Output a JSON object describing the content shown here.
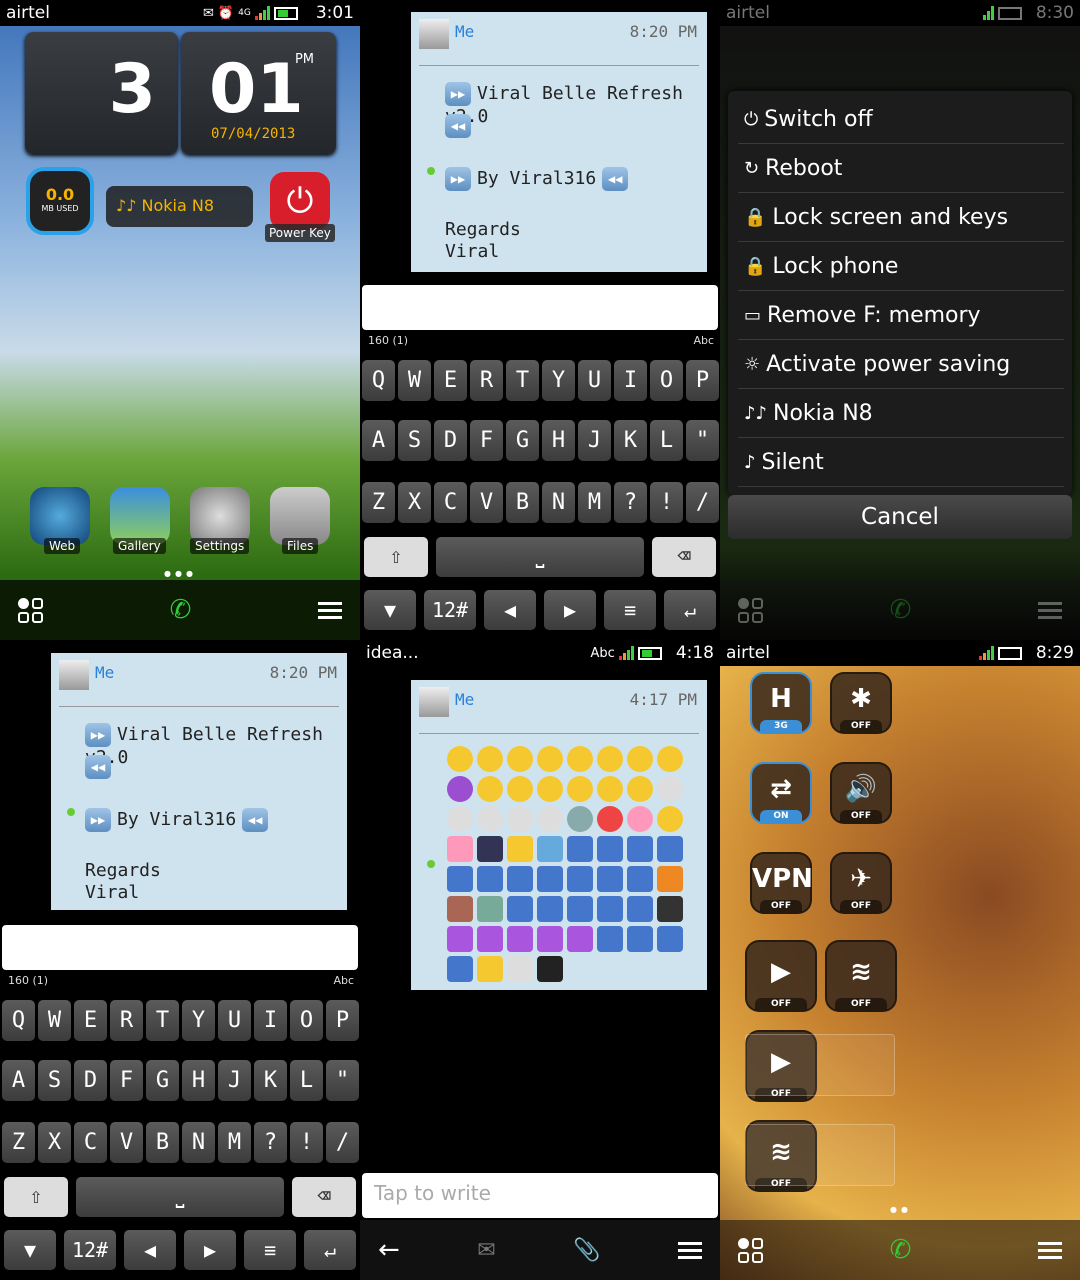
{
  "home": {
    "status": {
      "carrier": "airtel",
      "time": "3:01",
      "network": "4G"
    },
    "clock": {
      "hour": "3",
      "minute": "01",
      "ampm": "PM",
      "date": "07/04/2013"
    },
    "data_widget": {
      "value": "0.0",
      "label": "MB USED"
    },
    "profile_widget": {
      "label": "♪♪ Nokia N8"
    },
    "power_key": {
      "label": "Power Key"
    },
    "apps": [
      {
        "label": "Web",
        "icon": "globe-icon"
      },
      {
        "label": "Gallery",
        "icon": "landscape-icon"
      },
      {
        "label": "Settings",
        "icon": "gear-icon"
      },
      {
        "label": "Files",
        "icon": "folder-icon"
      }
    ]
  },
  "message": {
    "sender": "Me",
    "time": "8:20 PM",
    "line1": "Viral Belle Refresh v2.0",
    "line2": "By Viral316",
    "line3": "Regards",
    "line4": "Viral",
    "counter": "160 (1)",
    "input_mode": "Abc"
  },
  "keyboard": {
    "rows": [
      [
        "Q",
        "W",
        "E",
        "R",
        "T",
        "Y",
        "U",
        "I",
        "O",
        "P"
      ],
      [
        "A",
        "S",
        "D",
        "F",
        "G",
        "H",
        "J",
        "K",
        "L",
        "\""
      ],
      [
        "Z",
        "X",
        "C",
        "V",
        "B",
        "N",
        "M",
        "?",
        "!",
        "/"
      ]
    ],
    "shift": "⇧",
    "space": "⎵",
    "backspace": "⌫",
    "toolbar": [
      "▼",
      "12#",
      "◀",
      "▶",
      "≡",
      "↵"
    ]
  },
  "power_menu": {
    "status": {
      "carrier": "airtel",
      "time": "8:30"
    },
    "items": [
      {
        "icon": "⏻",
        "label": "Switch off"
      },
      {
        "icon": "↻",
        "label": "Reboot"
      },
      {
        "icon": "🔒",
        "label": "Lock screen and keys"
      },
      {
        "icon": "🔒",
        "label": "Lock phone"
      },
      {
        "icon": "▭",
        "label": "Remove F: memory"
      },
      {
        "icon": "☼",
        "label": "Activate power saving"
      },
      {
        "icon": "♪♪",
        "label": "Nokia N8"
      },
      {
        "icon": "♪",
        "label": "Silent"
      }
    ],
    "cancel": "Cancel"
  },
  "emoji_chat": {
    "status": {
      "carrier": "idea...",
      "mode": "Abc",
      "time": "4:18"
    },
    "sender": "Me",
    "time": "4:17 PM",
    "placeholder": "Tap to write"
  },
  "toggles": {
    "status": {
      "carrier": "airtel",
      "time": "8:29"
    },
    "items": [
      {
        "icon": "H",
        "state": "3G",
        "on": true
      },
      {
        "icon": "✱",
        "state": "OFF"
      },
      {
        "icon": "⇄",
        "state": "ON",
        "on": true
      },
      {
        "icon": "🔊",
        "state": "OFF"
      },
      {
        "icon": "VPN",
        "state": "OFF"
      },
      {
        "icon": "✈",
        "state": "OFF"
      },
      {
        "icon": "▶",
        "state": "OFF"
      },
      {
        "icon": "≋",
        "state": "OFF"
      },
      {
        "icon": "▶",
        "state": "OFF"
      },
      {
        "icon": "≋",
        "state": "OFF"
      }
    ]
  }
}
